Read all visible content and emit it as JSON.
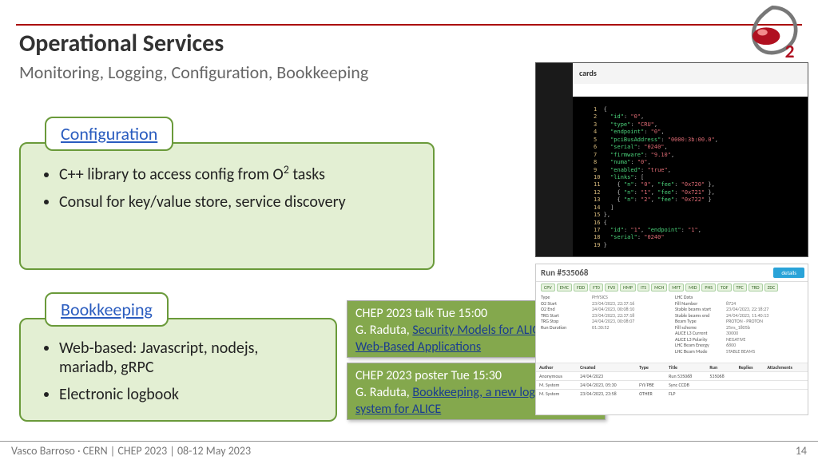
{
  "header": {
    "title": "Operational Services",
    "subtitle": "Monitoring, Logging, Configuration, Bookkeeping"
  },
  "card1": {
    "tab": "Configuration",
    "line1_pre": "C++ library to access config from O",
    "line1_sup": "2",
    "line1_post": " tasks",
    "line2": "Consul for key/value store, service discovery"
  },
  "card2": {
    "tab": "Bookkeeping",
    "b1": "Web-based: Javascript, nodejs, mariadb, gRPC",
    "b2": "Electronic logbook"
  },
  "callout1": {
    "line1": "CHEP 2023 talk Tue 15:00",
    "author": "G. Raduta, ",
    "link": "Security Models for ALICE Online Web-Based Applications"
  },
  "callout2": {
    "line1": "CHEP 2023 poster Tue 15:30",
    "author": "G. Raduta, ",
    "link": "Bookkeeping, a new logbook system for ALICE"
  },
  "shot1": {
    "title": "cards"
  },
  "shot2": {
    "run": "Run #535068",
    "left": [
      {
        "k": "Type",
        "v": "PHYSICS"
      },
      {
        "k": "O2 Start",
        "v": "23/04/2023, 22:37:16"
      },
      {
        "k": "O2 End",
        "v": "24/04/2023, 00:08:10"
      },
      {
        "k": "TRG Start",
        "v": "23/04/2023, 22:37:18"
      },
      {
        "k": "TRG Stop",
        "v": "24/04/2023, 00:08:07"
      },
      {
        "k": "Run Duration",
        "v": "01:30:52"
      }
    ],
    "right": [
      {
        "k": "LHC Data",
        "v": ""
      },
      {
        "k": "Fill Number",
        "v": "8724"
      },
      {
        "k": "Stable beams start",
        "v": "23/04/2023, 22:18:27"
      },
      {
        "k": "Stable beams end",
        "v": "24/04/2023, 11:40:13"
      },
      {
        "k": "Beam Type",
        "v": "PROTON - PROTON"
      },
      {
        "k": "Fill scheme",
        "v": "25ns_1805b"
      },
      {
        "k": "ALICE L3 Current",
        "v": "30000"
      },
      {
        "k": "ALICE L3 Polarity",
        "v": "NEGATIVE"
      },
      {
        "k": "LHC Beam Energy",
        "v": "6800"
      },
      {
        "k": "LHC Beam Mode",
        "v": "STABLE BEAMS"
      }
    ],
    "table": {
      "head": [
        "Author",
        "Created",
        "Type",
        "Title",
        "Run",
        "Replies",
        "Attachments"
      ],
      "rows": [
        [
          "Anonymous",
          "24/04/2023",
          "",
          "Run 535068",
          "535068",
          "",
          ""
        ],
        [
          "M. System",
          "24/04/2023, 05:30",
          "FYI/PBE",
          "Sync CCDB",
          "",
          "",
          ""
        ],
        [
          "M. System",
          "23/04/2023, 23:58",
          "OTHER",
          "FLP",
          "",
          "",
          ""
        ]
      ]
    }
  },
  "footer": {
    "left": "Vasco Barroso · CERN | CHEP 2023 | 08-12 May 2023",
    "right": "14"
  }
}
